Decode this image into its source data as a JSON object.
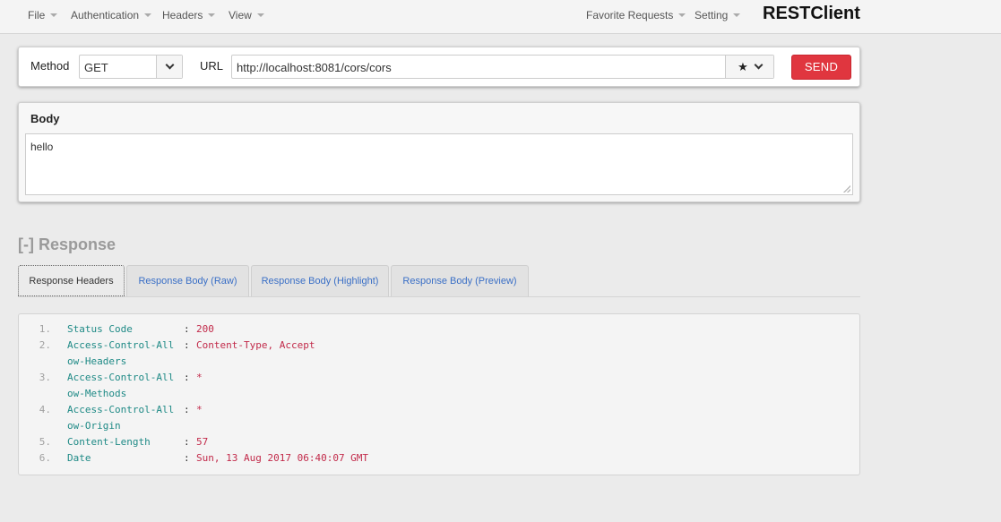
{
  "menu": {
    "file": "File",
    "authentication": "Authentication",
    "headers": "Headers",
    "view": "View",
    "favorite_requests": "Favorite Requests",
    "setting": "Setting",
    "brand": "RESTClient"
  },
  "request": {
    "method_label": "Method",
    "method_value": "GET",
    "url_label": "URL",
    "url_value": "http://localhost:8081/cors/cors",
    "favorite_icon": "★",
    "send_label": "SEND"
  },
  "body": {
    "title": "Body",
    "value": "hello"
  },
  "response": {
    "title": "[-] Response",
    "tabs": [
      "Response Headers",
      "Response Body (Raw)",
      "Response Body (Highlight)",
      "Response Body (Preview)"
    ],
    "active_tab": 0,
    "lines": [
      {
        "num": "1.",
        "key": "Status Code",
        "key2": "",
        "value": "200"
      },
      {
        "num": "2.",
        "key": "Access-Control-All",
        "key2": "ow-Headers",
        "value": "Content-Type, Accept"
      },
      {
        "num": "3.",
        "key": "Access-Control-All",
        "key2": "ow-Methods",
        "value": "*"
      },
      {
        "num": "4.",
        "key": "Access-Control-All",
        "key2": "ow-Origin",
        "value": "*"
      },
      {
        "num": "5.",
        "key": "Content-Length",
        "key2": "",
        "value": "57"
      },
      {
        "num": "6.",
        "key": "Date",
        "key2": "",
        "value": "Sun, 13 Aug 2017 06:40:07 GMT"
      }
    ]
  },
  "colors": {
    "send": "#e0363f",
    "header_key": "#1f8a86",
    "header_value": "#c22a4a",
    "tab_link": "#3a6fc6"
  }
}
